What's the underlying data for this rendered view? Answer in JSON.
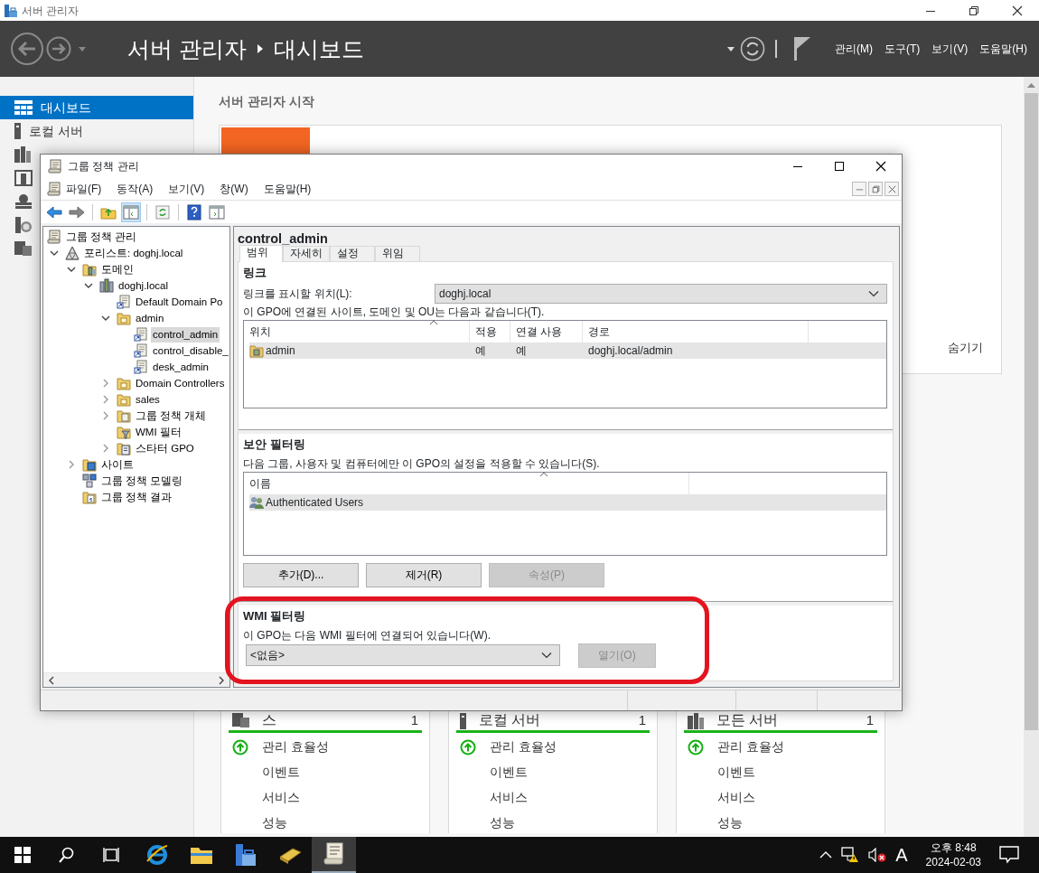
{
  "server_manager": {
    "title": "서버 관리자",
    "breadcrumb": [
      "서버 관리자",
      "대시보드"
    ],
    "menus": [
      "관리(M)",
      "도구(T)",
      "보기(V)",
      "도움말(H)"
    ],
    "sidebar": [
      {
        "label": "대시보드",
        "selected": true
      },
      {
        "label": "로컬 서버",
        "selected": false
      },
      {
        "selected": false
      },
      {
        "selected": false
      },
      {
        "selected": false
      },
      {
        "selected": false
      },
      {
        "selected": false
      }
    ],
    "welcome": {
      "heading": "서버 관리자 시작",
      "hide_link": "숨기기"
    },
    "tiles": [
      {
        "title": "스",
        "count": "1",
        "rows": [
          {
            "label": "관리 효율성",
            "healthy": true
          },
          {
            "label": "이벤트",
            "healthy": false
          },
          {
            "label": "서비스",
            "healthy": false
          },
          {
            "label": "성능",
            "healthy": false
          }
        ]
      },
      {
        "title": "로컬 서버",
        "count": "1",
        "rows": [
          {
            "label": "관리 효율성",
            "healthy": true
          },
          {
            "label": "이벤트",
            "healthy": false
          },
          {
            "label": "서비스",
            "healthy": false
          },
          {
            "label": "성능",
            "healthy": false
          }
        ]
      },
      {
        "title": "모든 서버",
        "count": "1",
        "rows": [
          {
            "label": "관리 효율성",
            "healthy": true
          },
          {
            "label": "이벤트",
            "healthy": false
          },
          {
            "label": "서비스",
            "healthy": false
          },
          {
            "label": "성능",
            "healthy": false
          }
        ]
      }
    ]
  },
  "gpmc": {
    "title": "그룹 정책 관리",
    "menus": [
      "파일(F)",
      "동작(A)",
      "보기(V)",
      "창(W)",
      "도움말(H)"
    ],
    "tree": [
      {
        "label": "그룹 정책 관리",
        "kind": "root",
        "selected": false,
        "children": [
          {
            "label": "포리스트: doghj.local",
            "kind": "forest",
            "expanded": true,
            "selected": false,
            "children": [
              {
                "label": "도메인",
                "kind": "domains",
                "expanded": true,
                "selected": false,
                "children": [
                  {
                    "label": "doghj.local",
                    "kind": "domain",
                    "expanded": true,
                    "selected": false,
                    "children": [
                      {
                        "label": "Default Domain Po",
                        "kind": "gpo-link",
                        "selected": false
                      },
                      {
                        "label": "admin",
                        "kind": "ou",
                        "expanded": true,
                        "selected": false,
                        "children": [
                          {
                            "label": "control_admin",
                            "kind": "gpo-link",
                            "selected": true
                          },
                          {
                            "label": "control_disable_",
                            "kind": "gpo-link",
                            "selected": false
                          },
                          {
                            "label": "desk_admin",
                            "kind": "gpo-link",
                            "selected": false
                          }
                        ]
                      },
                      {
                        "label": "Domain Controllers",
                        "kind": "ou",
                        "expanded": false,
                        "selected": false
                      },
                      {
                        "label": "sales",
                        "kind": "ou",
                        "expanded": false,
                        "selected": false
                      },
                      {
                        "label": "그룹 정책 개체",
                        "kind": "gpo-folder",
                        "expanded": false,
                        "selected": false
                      },
                      {
                        "label": "WMI 필터",
                        "kind": "wmi-folder",
                        "selected": false
                      },
                      {
                        "label": "스타터 GPO",
                        "kind": "starter-folder",
                        "expanded": false,
                        "selected": false
                      }
                    ]
                  }
                ]
              },
              {
                "label": "사이트",
                "kind": "sites",
                "expanded": false,
                "selected": false
              },
              {
                "label": "그룹 정책 모델링",
                "kind": "modeling",
                "selected": false
              },
              {
                "label": "그룹 정책 결과",
                "kind": "results",
                "selected": false
              }
            ]
          }
        ]
      }
    ],
    "detail": {
      "title": "control_admin",
      "tabs": [
        {
          "label": "범위",
          "selected": true
        },
        {
          "label": "자세히",
          "selected": false
        },
        {
          "label": "설정",
          "selected": false
        },
        {
          "label": "위임",
          "selected": false
        }
      ],
      "links": {
        "heading": "링크",
        "location_label": "링크를 표시할 위치(L):",
        "location_value": "doghj.local",
        "description": "이 GPO에 연결된 사이트, 도메인 및 OU는 다음과 같습니다(T).",
        "columns": [
          "위치",
          "적용",
          "연결 사용",
          "경로"
        ],
        "rows": [
          {
            "cells": [
              "admin",
              "예",
              "예",
              "doghj.local/admin"
            ],
            "selected": true
          }
        ]
      },
      "security": {
        "heading": "보안 필터링",
        "description": "다음 그룹, 사용자 및 컴퓨터에만 이 GPO의 설정을 적용할 수 있습니다(S).",
        "columns": [
          "이름"
        ],
        "rows": [
          {
            "name": "Authenticated Users",
            "selected": true
          }
        ],
        "buttons": [
          {
            "label": "추가(D)...",
            "disabled": false
          },
          {
            "label": "제거(R)",
            "disabled": false
          },
          {
            "label": "속성(P)",
            "disabled": true
          }
        ]
      },
      "wmi": {
        "heading": "WMI 필터링",
        "description": "이 GPO는 다음 WMI 필터에 연결되어 있습니다(W).",
        "value": "<없음>",
        "button": {
          "label": "열기(O)",
          "disabled": true
        }
      }
    }
  },
  "taskbar": {
    "apps": [
      {
        "selected": false
      },
      {
        "selected": false
      },
      {
        "selected": false
      },
      {
        "selected": false
      },
      {
        "selected": true
      }
    ],
    "ime": "A",
    "time": "오후 8:48",
    "date": "2024-02-03"
  }
}
